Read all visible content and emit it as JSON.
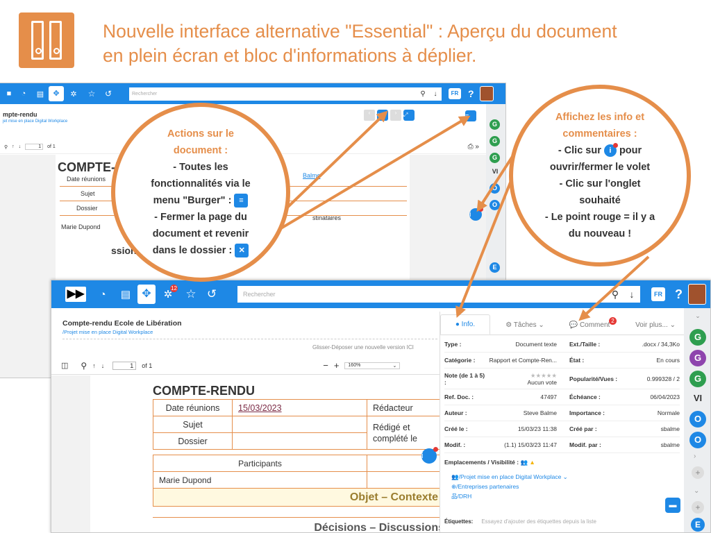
{
  "header": {
    "title_line1": "Nouvelle interface alternative \"Essential\" : Aperçu du document",
    "title_line2": "en plein écran et bloc d'informations à déplier."
  },
  "back_app": {
    "search_placeholder": "Rechercher",
    "lang": "FR",
    "help": "?",
    "doc_title": "mpte-rendu",
    "breadcrumb": "jet mise en place Digital Workplace",
    "page_label": "of 1",
    "page_value": "1",
    "sheet_title": "COMPTE-RE",
    "table_rows": [
      "Date réunions",
      "Sujet",
      "Dossier"
    ],
    "participant": "Marie Dupond",
    "name_frag": "Balme",
    "dest_frag": "stinataires",
    "section_frag": "ssions",
    "rail_letters": [
      "G",
      "G",
      "G",
      "VI",
      "O",
      "O",
      "E"
    ]
  },
  "front_app": {
    "search_placeholder": "Rechercher",
    "lang": "FR",
    "help": "?",
    "badge_count": "12",
    "doc_title": "Compte-rendu Ecole de Libération",
    "breadcrumb": "/Projet mise en place Digital Workplace",
    "drop_hint": "Glisser-Déposer une nouvelle version ICI",
    "page_value": "1",
    "page_label": "of 1",
    "zoom": "160%",
    "sheet": {
      "title": "COMPTE-RENDU",
      "r1l": "Date réunions",
      "r1v": "15/03/2023",
      "r1c": "Rédacteur",
      "r2l": "Sujet",
      "r2c": "Rédigé et complété le",
      "r3l": "Dossier",
      "participants": "Participants",
      "participant": "Marie Dupond",
      "objet": "Objet – Contexte",
      "decisions": "Décisions – Discussions"
    },
    "panel": {
      "tabs": {
        "info": "Info.",
        "taches": "Tâches ⌄",
        "comment": "Comment",
        "comment_badge": "2",
        "more": "Voir plus... ⌄"
      },
      "rows": [
        {
          "l": "Type :",
          "v": "Document texte",
          "l2": "Ext./Taille :",
          "v2": ".docx / 34,3Ko"
        },
        {
          "l": "Catégorie :",
          "v": "Rapport et Compte-Ren...",
          "l2": "État :",
          "v2": "En cours"
        },
        {
          "l": "Note (de 1 à 5) :",
          "v": "Aucun vote",
          "l2": "Popularité/Vues :",
          "v2": "0.999328 / 2"
        },
        {
          "l": "Ref. Doc. :",
          "v": "47497",
          "l2": "Échéance :",
          "v2": "06/04/2023"
        },
        {
          "l": "Auteur :",
          "v": "Steve Balme",
          "l2": "Importance :",
          "v2": "Normale"
        },
        {
          "l": "Créé le :",
          "v": "15/03/23 11:38",
          "l2": "Créé par :",
          "v2": "sbalme"
        },
        {
          "l": "Modif. :",
          "v": "(1.1) 15/03/23 11:47",
          "l2": "Modif. par :",
          "v2": "sbalme"
        }
      ],
      "stars": "★★★★★",
      "locations_title": "Emplacements / Visibilité :",
      "locations": [
        "/Projet mise en place Digital Workplace",
        "/Entreprises partenaires",
        "/DRH"
      ],
      "tags_label": "Étiquettes:",
      "tags_placeholder": "Essayez d'ajouter des étiquettes depuis la liste"
    },
    "rail_letters": [
      "G",
      "G",
      "G",
      "VI",
      "O",
      "O",
      "E"
    ]
  },
  "callout_left": {
    "l1": "Actions sur le",
    "l2": "document :",
    "l3": "- Toutes les",
    "l4": "fonctionnalités via le",
    "l5": "menu \"Burger\" :",
    "l6": "- Fermer la page du",
    "l7": "document et revenir",
    "l8": "dans le dossier :"
  },
  "callout_right": {
    "l1": "Affichez les info et",
    "l2": "commentaires :",
    "l3": "- Clic sur",
    "l3b": "pour",
    "l4": "ouvrir/fermer le volet",
    "l5": "- Clic sur l'onglet",
    "l6": "souhaité",
    "l7": "- Le point rouge = il y a",
    "l8": "du nouveau !"
  },
  "colors": {
    "accent": "#e58e4a",
    "brand": "#1e88e5"
  }
}
